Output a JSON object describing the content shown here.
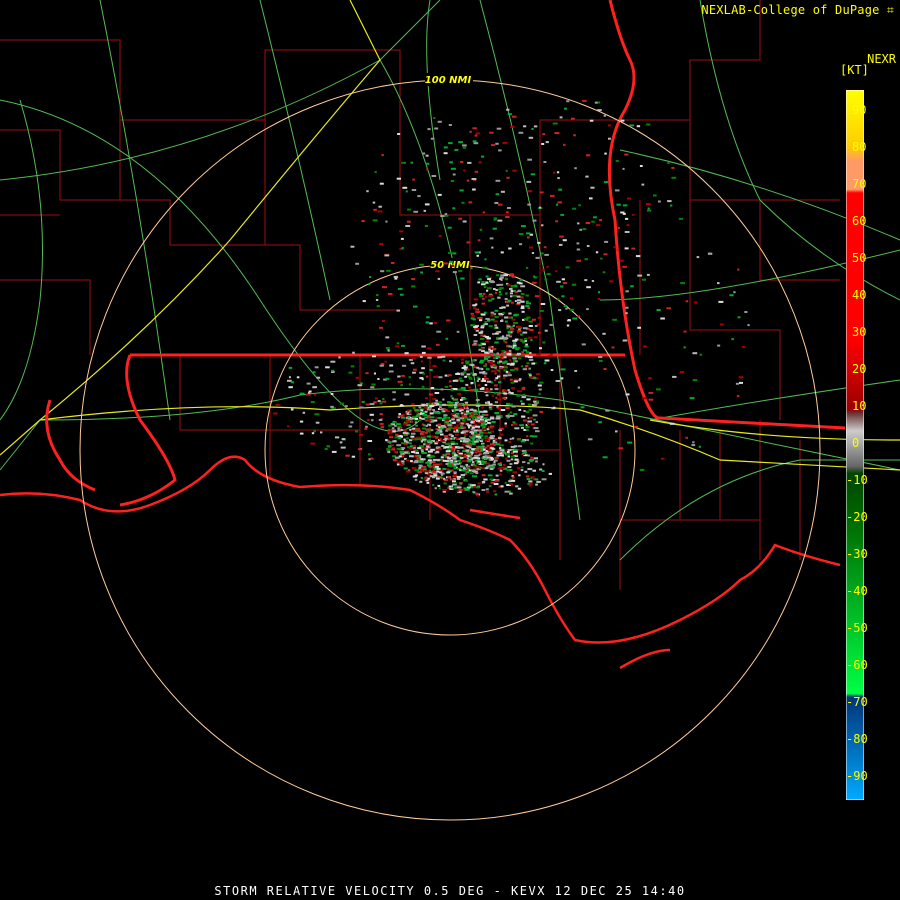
{
  "header": {
    "credit": "NEXLAB-College of DuPage",
    "product_code": "NEXR",
    "unit_label": "[KT]"
  },
  "legend": {
    "ticks": [
      "90",
      "80",
      "70",
      "60",
      "50",
      "40",
      "30",
      "20",
      "10",
      "0",
      "-10",
      "-20",
      "-30",
      "-40",
      "-50",
      "-60",
      "-70",
      "-80",
      "-90"
    ],
    "colors": {
      "positive_high": "#ffff00",
      "positive_mid": "#ff0000",
      "zero": "#888888",
      "negative_mid": "#00cc33",
      "negative_low": "#0077ff"
    }
  },
  "map": {
    "ring_labels": [
      "100 NMI",
      "50 NMI"
    ],
    "colors": {
      "state_border": "#ff2020",
      "county_border": "#cc1010",
      "highway": "#66cc66",
      "interstate": "#ffff33",
      "range_ring": "#ffcc99"
    }
  },
  "caption": "STORM RELATIVE VELOCITY 0.5 DEG - KEVX 12 DEC 25 14:40"
}
